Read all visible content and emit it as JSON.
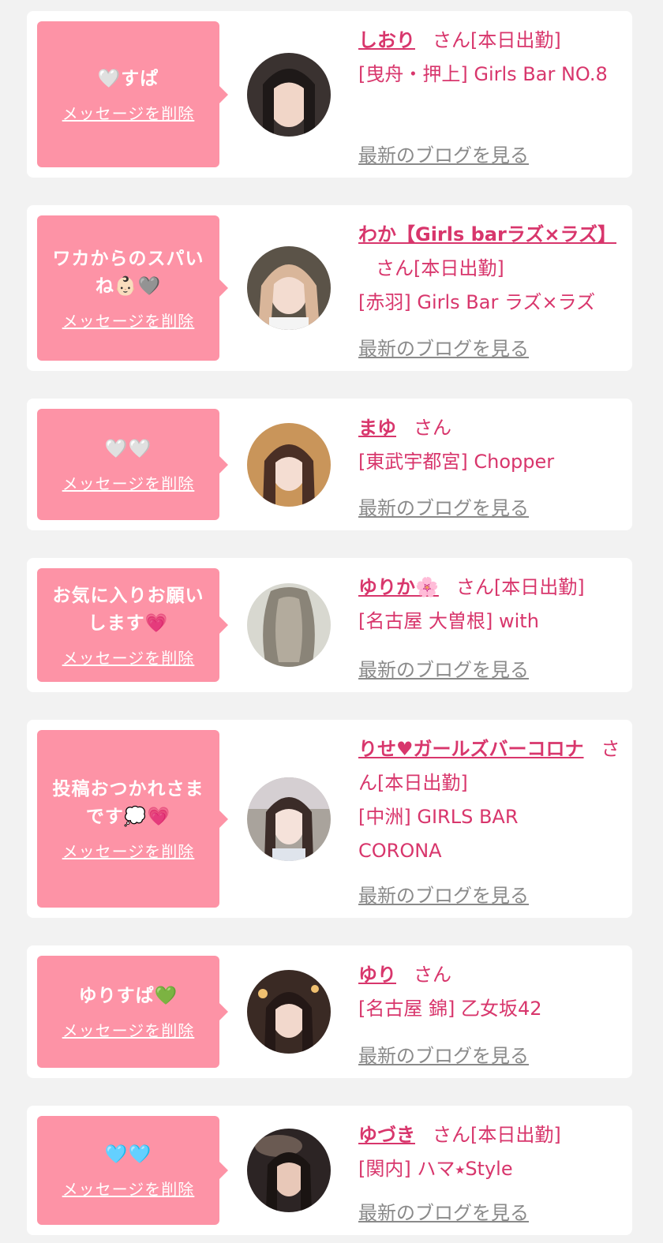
{
  "common": {
    "delete_label": "メッセージを削除",
    "blog_label": "最新のブログを見る",
    "san": "さん"
  },
  "colors": {
    "bubble": "#fd93a6",
    "accent": "#d8366c",
    "link_gray": "#8a8a8a",
    "background": "#f2f2f2"
  },
  "favorites": [
    {
      "message": "🤍すぱ",
      "name": "しおり",
      "status": "[本日出勤]",
      "shop": "[曳舟・押上] Girls Bar NO.8"
    },
    {
      "message": "ワカからのスパいね👶🏻🩶",
      "name": "わか【Girls barラズ×ラズ】",
      "status": "[本日出勤]",
      "shop": "[赤羽] Girls Bar ラズ×ラズ"
    },
    {
      "message": "🤍🤍",
      "name": "まゆ",
      "status": "",
      "shop": "[東武宇都宮] Chopper"
    },
    {
      "message": "お気に入りお願いします💗",
      "name": "ゆりか🌸",
      "status": "[本日出勤]",
      "shop": "[名古屋 大曽根] with"
    },
    {
      "message": "投稿おつかれさまです💭💗",
      "name": "りせ♥ガールズバーコロナ",
      "status": "[本日出勤]",
      "shop": "[中洲] GIRLS BAR CORONA"
    },
    {
      "message": "ゆりすぱ💚",
      "name": "ゆり",
      "status": "",
      "shop": "[名古屋 錦] 乙女坂42"
    },
    {
      "message": "🩵🩵",
      "name": "ゆづき",
      "status": "[本日出勤]",
      "shop": "[関内] ハマ⭑Style"
    }
  ]
}
